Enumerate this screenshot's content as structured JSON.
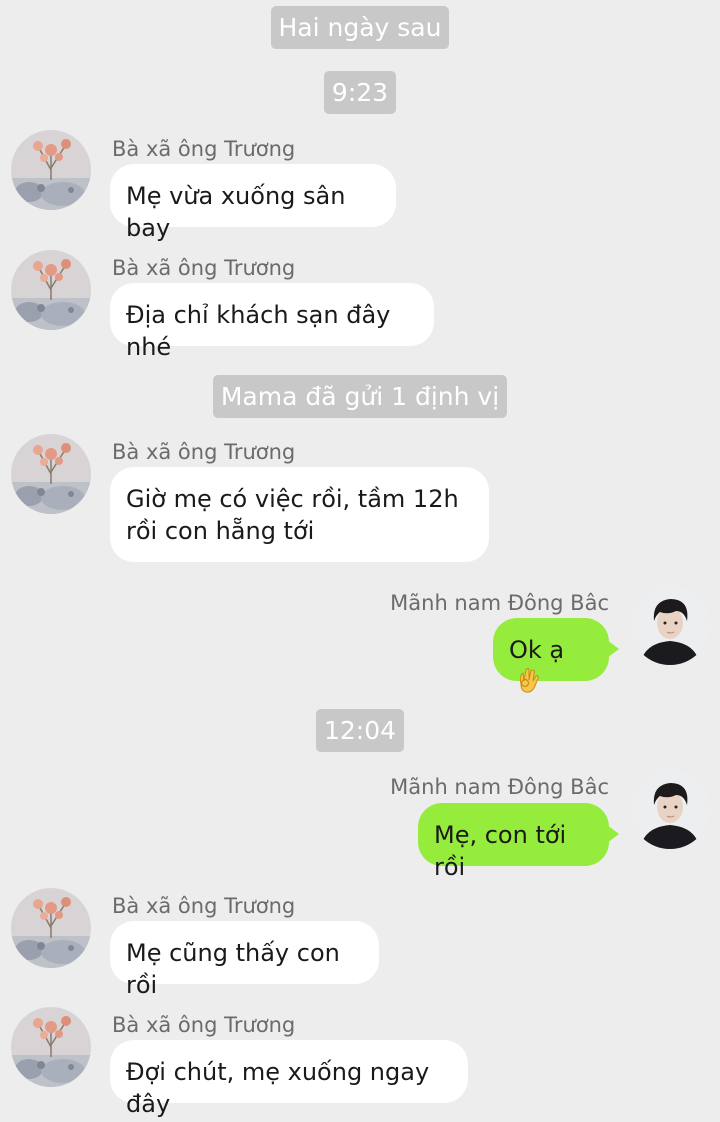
{
  "system": {
    "day_label": "Hai ngày sau",
    "time_1": "9:23",
    "location_notice": "Mama đã gửi 1 định vị",
    "time_2": "12:04"
  },
  "contacts": {
    "left_name": "Bà xã ông Trương",
    "right_name": "Mãnh nam Đông Bâc"
  },
  "messages": [
    {
      "from": "left",
      "text": "Mẹ vừa xuống sân bay"
    },
    {
      "from": "left",
      "text": "Địa chỉ khách sạn đây nhé"
    },
    {
      "from": "left",
      "text": "Giờ mẹ có việc rồi, tầm 12h rồi con hẵng tới"
    },
    {
      "from": "right",
      "text": "Ok ạ",
      "emoji": "ok-hand-emoji"
    },
    {
      "from": "right",
      "text": "Mẹ, con tới rồi"
    },
    {
      "from": "left",
      "text": "Mẹ cũng thấy con rồi"
    },
    {
      "from": "left",
      "text": "Đợi chút, mẹ xuống ngay đây"
    }
  ],
  "colors": {
    "background": "#ededed",
    "incoming_bubble": "#ffffff",
    "outgoing_bubble": "#95ec3c",
    "system_pill": "#c8c8c8"
  }
}
